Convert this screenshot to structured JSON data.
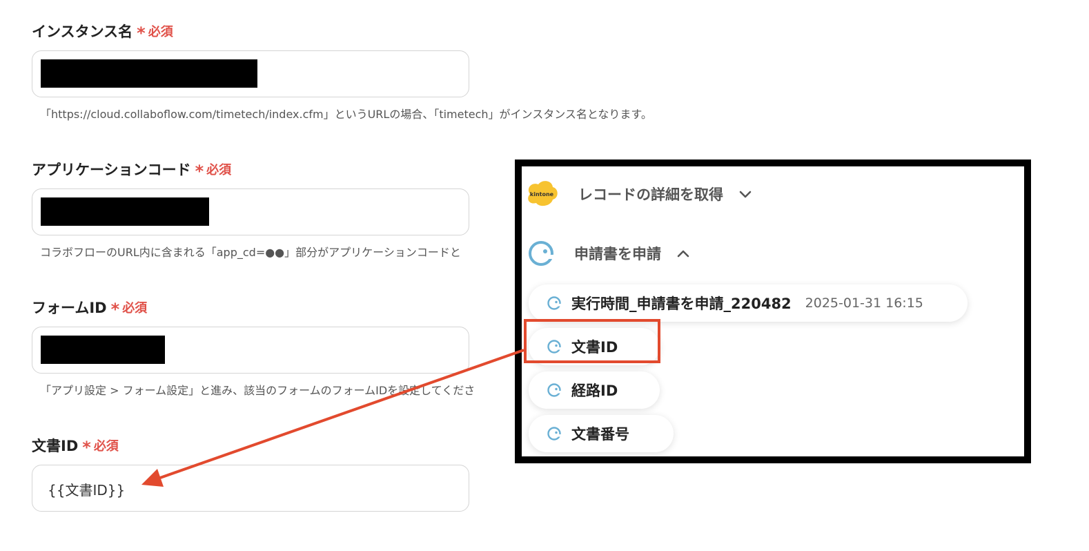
{
  "form": {
    "required_label": "必須",
    "fields": [
      {
        "label": "インスタンス名",
        "hint": "「https://cloud.collaboflow.com/timetech/index.cfm」というURLの場合、「timetech」がインスタンス名となります。"
      },
      {
        "label": "アプリケーションコード",
        "hint": "コラボフローのURL内に含まれる「app_cd=●●」部分がアプリケーションコードと"
      },
      {
        "label": "フォームID",
        "hint": "「アプリ設定 > フォーム設定」と進み、該当のフォームのフォームIDを設定してくださ"
      },
      {
        "label": "文書ID",
        "value": "{{文書ID}}"
      }
    ]
  },
  "panel": {
    "steps": [
      {
        "app_icon": "kintone-logo",
        "app_icon_text": "kintone",
        "label": "レコードの詳細を取得",
        "expanded": false
      },
      {
        "app_icon": "collaboflow-icon",
        "label": "申請書を申請",
        "expanded": true
      }
    ],
    "outputs": [
      {
        "label": "実行時間_申請書を申請_220482",
        "timestamp": "2025-01-31 16:15"
      },
      {
        "label": "文書ID"
      },
      {
        "label": "経路ID"
      },
      {
        "label": "文書番号"
      }
    ]
  },
  "colors": {
    "required": "#e0524a",
    "highlight": "#e24a2e",
    "kintone": "#f7c330",
    "collaboflow": "#6ab0d4"
  }
}
